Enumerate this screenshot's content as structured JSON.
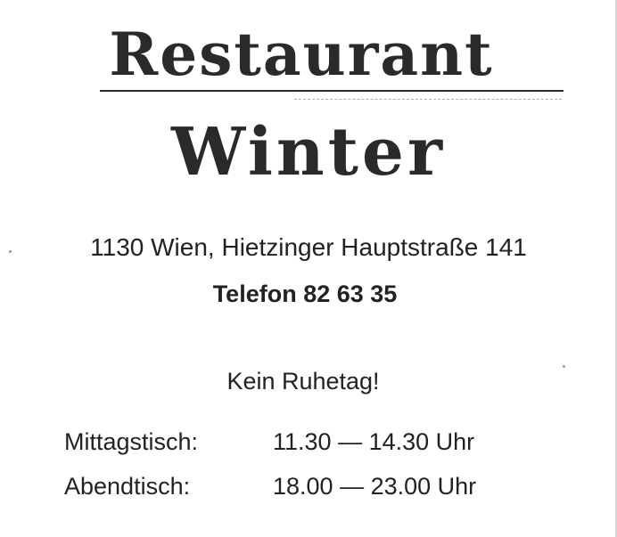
{
  "restaurant": {
    "title_line1": "Restaurant",
    "title_line2": "Winter",
    "address": "1130 Wien, Hietzinger Hauptstraße 141",
    "phone": "Telefon 82 63 35",
    "rest_day": "Kein Ruhetag!",
    "hours": [
      {
        "label": "Mittagstisch:",
        "time": "11.30 — 14.30 Uhr"
      },
      {
        "label": "Abendtisch:",
        "time": "18.00 — 23.00 Uhr"
      }
    ]
  },
  "colors": {
    "ink": "#222222",
    "paper": "#ffffff"
  }
}
